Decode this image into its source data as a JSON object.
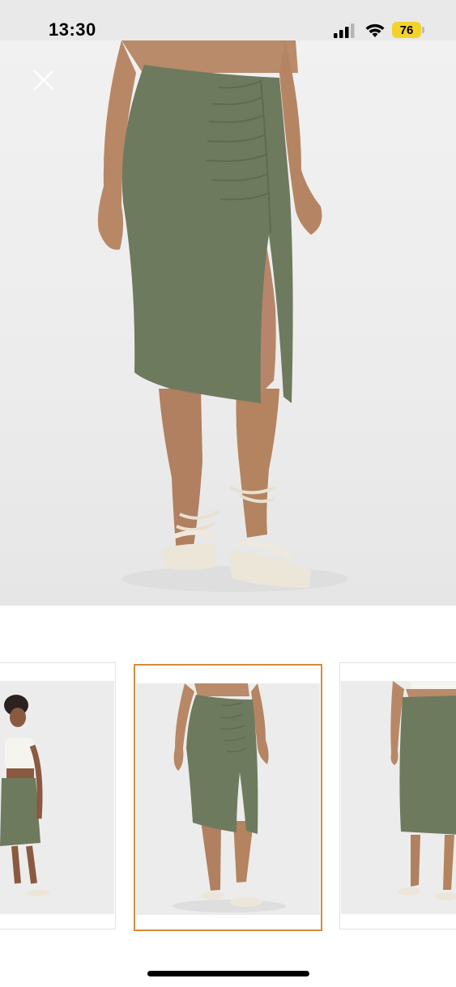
{
  "status_bar": {
    "time": "13:30",
    "battery_level": "76",
    "battery_color": "#f4d22c",
    "icons": [
      "signal-icon",
      "wifi-icon",
      "battery-icon"
    ]
  },
  "main_image": {
    "close_icon": "close-icon"
  },
  "thumbnails": {
    "selected_index": 1,
    "selected_border_color": "#d88a3c",
    "count_visible": 3
  },
  "colors": {
    "skirt_green": "#6e7a5e",
    "background": "#ffffff",
    "status_bar_bg": "#e9e9e9"
  }
}
